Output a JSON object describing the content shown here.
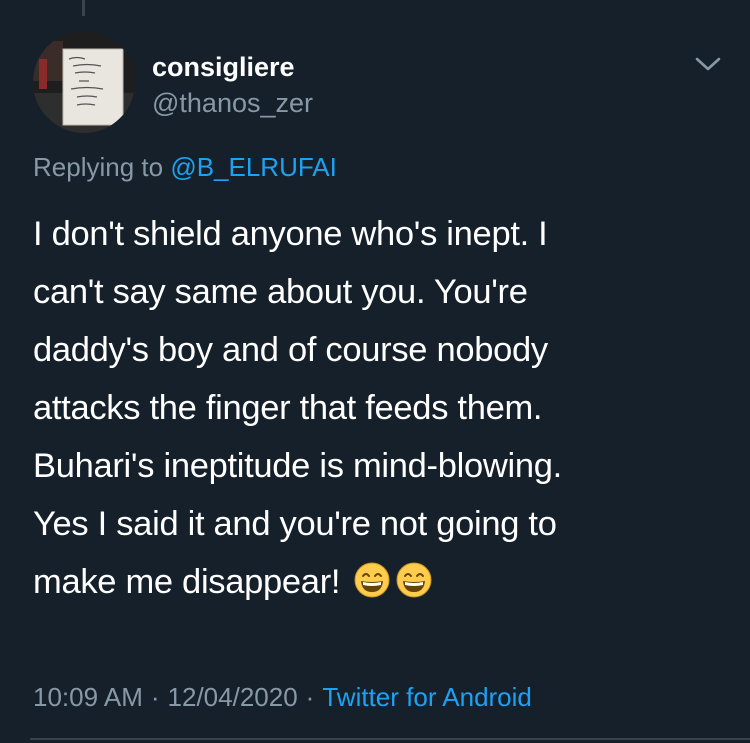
{
  "tweet": {
    "display_name": "consigliere",
    "handle": "@thanos_zer",
    "replying_prefix": "Replying to",
    "replying_to": "@B_ELRUFAI",
    "lines": [
      "I don't shield anyone who's inept. I",
      "can't say same about you. You're",
      "daddy's boy and of course nobody",
      "attacks the finger that feeds them.",
      "Buhari's ineptitude is mind-blowing.",
      "Yes I said it and you're not going to",
      "make me disappear!"
    ],
    "emoji": [
      "grinning-face-with-smiling-eyes",
      "grinning-face-with-smiling-eyes"
    ],
    "time": "10:09 AM",
    "separator": "·",
    "date": "12/04/2020",
    "client": "Twitter for Android"
  },
  "icons": {
    "caret": "chevron-down-icon",
    "avatar": "profile-photo"
  },
  "colors": {
    "background": "#15202b",
    "primary_text": "#ffffff",
    "secondary_text": "#8899a6",
    "link": "#1da1f2",
    "divider": "#38444d",
    "emoji_fill": "#ffcc4d"
  }
}
